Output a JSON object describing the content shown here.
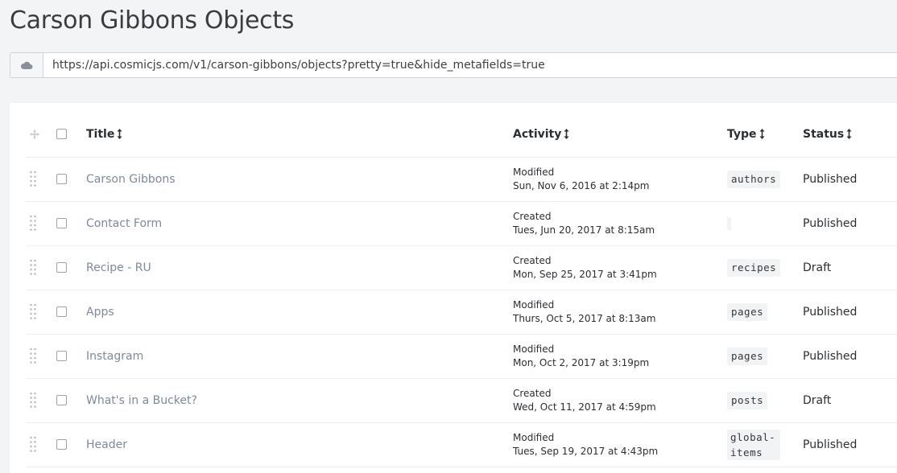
{
  "page": {
    "title": "Carson Gibbons Objects"
  },
  "url_bar": {
    "icon": "cloud-icon",
    "url": "https://api.cosmicjs.com/v1/carson-gibbons/objects?pretty=true&hide_metafields=true"
  },
  "table": {
    "headers": {
      "title": "Title",
      "activity": "Activity",
      "type": "Type",
      "status": "Status"
    },
    "rows": [
      {
        "title": "Carson Gibbons",
        "activity_action": "Modified",
        "activity_date": "Sun, Nov 6, 2016 at 2:14pm",
        "type": "authors",
        "status": "Published"
      },
      {
        "title": "Contact Form",
        "activity_action": "Created",
        "activity_date": "Tues, Jun 20, 2017 at 8:15am",
        "type": "",
        "status": "Published"
      },
      {
        "title": "Recipe - RU",
        "activity_action": "Created",
        "activity_date": "Mon, Sep 25, 2017 at 3:41pm",
        "type": "recipes",
        "status": "Draft"
      },
      {
        "title": "Apps",
        "activity_action": "Modified",
        "activity_date": "Thurs, Oct 5, 2017 at 8:13am",
        "type": "pages",
        "status": "Published"
      },
      {
        "title": "Instagram",
        "activity_action": "Modified",
        "activity_date": "Mon, Oct 2, 2017 at 3:19pm",
        "type": "pages",
        "status": "Published"
      },
      {
        "title": "What's in a Bucket?",
        "activity_action": "Created",
        "activity_date": "Wed, Oct 11, 2017 at 4:59pm",
        "type": "posts",
        "status": "Draft"
      },
      {
        "title": "Header",
        "activity_action": "Modified",
        "activity_date": "Tues, Sep 19, 2017 at 4:43pm",
        "type": "global-items",
        "status": "Published"
      }
    ]
  },
  "colors": {
    "title_link": "#7d8a98",
    "background": "#f3f4f6",
    "panel": "#ffffff",
    "badge_bg": "#f2f3f4"
  }
}
